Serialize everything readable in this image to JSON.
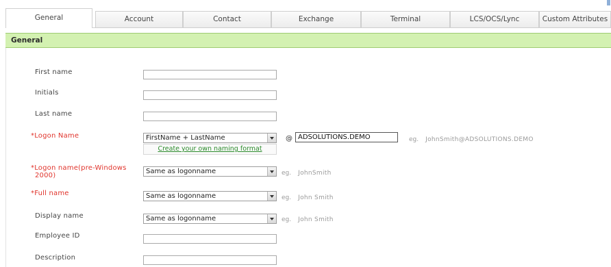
{
  "tabs": [
    {
      "label": "General",
      "active": true
    },
    {
      "label": "Account",
      "active": false
    },
    {
      "label": "Contact",
      "active": false
    },
    {
      "label": "Exchange",
      "active": false
    },
    {
      "label": "Terminal",
      "active": false
    },
    {
      "label": "LCS/OCS/Lync",
      "active": false
    },
    {
      "label": "Custom Attributes",
      "active": false
    }
  ],
  "section": {
    "title": "General"
  },
  "form": {
    "first_name": {
      "label": "First name",
      "value": ""
    },
    "initials": {
      "label": "Initials",
      "value": ""
    },
    "last_name": {
      "label": "Last name",
      "value": ""
    },
    "logon_name": {
      "label": "*Logon Name",
      "required": true,
      "selected": "FirstName + LastName",
      "at": "@",
      "domain": "ADSOLUTIONS.DEMO",
      "example_prefix": "eg.",
      "example": "JohnSmith@ADSOLUTIONS.DEMO",
      "naming_link": "Create your own naming format"
    },
    "logon_pre2000": {
      "label_line1": "*Logon name(pre-Windows",
      "label_line2": "2000)",
      "required": true,
      "selected": "Same as logonname",
      "example_prefix": "eg.",
      "example": "JohnSmith"
    },
    "full_name": {
      "label": "*Full name",
      "required": true,
      "selected": "Same as logonname",
      "example_prefix": "eg.",
      "example": "John Smith"
    },
    "display_name": {
      "label": "Display name",
      "selected": "Same as logonname",
      "example_prefix": "eg.",
      "example": "John Smith"
    },
    "employee_id": {
      "label": "Employee ID",
      "value": ""
    },
    "description": {
      "label": "Description",
      "value": ""
    }
  },
  "colors": {
    "section_bg": "#d3f1b1",
    "required": "#e0332b",
    "link": "#2a8a2a"
  }
}
